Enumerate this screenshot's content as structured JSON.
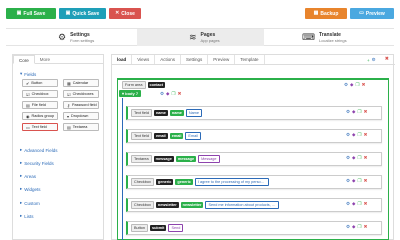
{
  "toolbar": {
    "full_save": "Full Save",
    "quick_save": "Quick Save",
    "close": "Close",
    "backup": "Backup",
    "preview": "Preview"
  },
  "nav_tabs": [
    {
      "title": "Settings",
      "subtitle": "Form settings",
      "icon": "gears-icon"
    },
    {
      "title": "Pages",
      "subtitle": "App pages",
      "icon": "layers-icon"
    },
    {
      "title": "Translate",
      "subtitle": "Localize strings",
      "icon": "translate-icon"
    }
  ],
  "sidebar": {
    "tabs": [
      "Core",
      "More"
    ],
    "fields_heading": "Fields",
    "fields": [
      {
        "label": "Button",
        "icon": "check-icon"
      },
      {
        "label": "Calendar",
        "icon": "calendar-icon"
      },
      {
        "label": "Checkbox",
        "icon": "checkbox-icon"
      },
      {
        "label": "Checkboxes",
        "icon": "checkboxes-icon"
      },
      {
        "label": "File field",
        "icon": "file-icon"
      },
      {
        "label": "Password field",
        "icon": "key-icon"
      },
      {
        "label": "Radios group",
        "icon": "radio-icon"
      },
      {
        "label": "Dropdown",
        "icon": "dropdown-icon"
      },
      {
        "label": "Text field",
        "icon": "text-icon"
      },
      {
        "label": "Textarea",
        "icon": "textarea-icon"
      }
    ],
    "sections": [
      "Advanced Fields",
      "Security Fields",
      "Areas",
      "Widgets",
      "Custom",
      "Lists"
    ]
  },
  "editor": {
    "tabs": [
      "load",
      "Views",
      "Actions",
      "Settings",
      "Preview",
      "Template"
    ],
    "form_area_label": "Form area",
    "form_area_name": "contact",
    "body_label": "body",
    "body_badge": "7"
  },
  "rows": [
    {
      "type": "Text field",
      "name": "name",
      "label": "name",
      "extra": "Name"
    },
    {
      "type": "Text field",
      "name": "email",
      "label": "email",
      "extra": "Email"
    },
    {
      "type": "Textarea",
      "name": "message",
      "label": "message",
      "extra": "Message"
    },
    {
      "type": "Checkbox",
      "name": "generic",
      "label": "generic",
      "extra": "I agree to the processing of my personal..."
    },
    {
      "type": "Checkbox",
      "name": "newsletter",
      "label": "newsletter",
      "extra": "Send me information about products, ser..."
    },
    {
      "type": "Button",
      "name": "submit",
      "label": "",
      "extra": "Send"
    }
  ],
  "colors": {
    "green": "#2bb04a",
    "blue": "#2c6bb8",
    "red": "#d9534f",
    "orange": "#e8842c",
    "light_blue": "#4aa8e0"
  }
}
